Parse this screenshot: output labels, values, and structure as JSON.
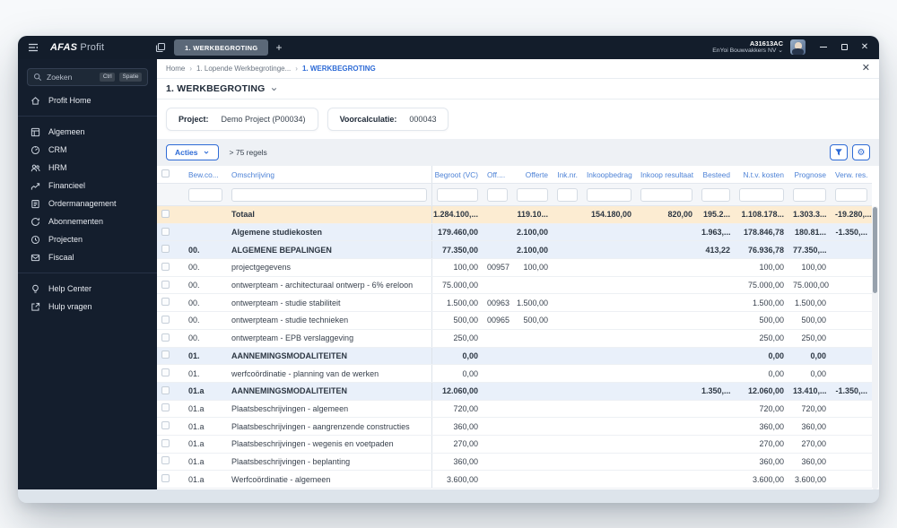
{
  "topbar": {
    "logo_primary": "AFAS",
    "logo_secondary": "Profit",
    "active_tab": "1. WERKBEGROTING",
    "user_id": "A31613AC",
    "company": "EnYoi Bouwvakkers NV"
  },
  "sidebar": {
    "search": {
      "placeholder": "Zoeken",
      "shortcut_keys": [
        "Ctrl",
        "Spatie"
      ]
    },
    "home_label": "Profit Home",
    "items": [
      {
        "icon": "grid-icon",
        "label": "Algemeen"
      },
      {
        "icon": "gauge-icon",
        "label": "CRM"
      },
      {
        "icon": "users-icon",
        "label": "HRM"
      },
      {
        "icon": "chart-icon",
        "label": "Financieel"
      },
      {
        "icon": "clipboard-icon",
        "label": "Ordermanagement"
      },
      {
        "icon": "refresh-icon",
        "label": "Abonnementen"
      },
      {
        "icon": "clock-icon",
        "label": "Projecten"
      },
      {
        "icon": "mail-icon",
        "label": "Fiscaal"
      }
    ],
    "footer_items": [
      {
        "icon": "bulb-icon",
        "label": "Help Center"
      },
      {
        "icon": "external-link-icon",
        "label": "Hulp vragen"
      }
    ]
  },
  "breadcrumb": [
    "Home",
    "1. Lopende Werkbegrotinge...",
    "1. WERKBEGROTING"
  ],
  "page": {
    "title": "1. WERKBEGROTING"
  },
  "info_cards": [
    {
      "label": "Project:",
      "value": "Demo Project (P00034)"
    },
    {
      "label": "Voorcalculatie:",
      "value": "000043"
    }
  ],
  "toolbar": {
    "actions_label": "Acties",
    "count_label": "> 75 regels"
  },
  "table": {
    "columns": [
      "",
      "Bew.co...",
      "Omschrijving",
      "Begroot (VC)",
      "Off....",
      "Offerte",
      "Ink.nr.",
      "Inkoopbedrag",
      "Inkoop resultaat",
      "Besteed",
      "N.t.v. kosten",
      "Prognose",
      "Verw. res."
    ],
    "rows": [
      {
        "variant": "total",
        "code": "",
        "descr": "Totaal",
        "begroot": "1.284.100,...",
        "offnr": "",
        "offerte": "119.10...",
        "inknr": "",
        "inkoop": "154.180,00",
        "inkres": "820,00",
        "besteed": "195.2...",
        "ntv": "1.108.178...",
        "prognose": "1.303.3...",
        "verw": "-19.280,..."
      },
      {
        "variant": "group",
        "code": "",
        "descr": "Algemene studiekosten",
        "begroot": "179.460,00",
        "offnr": "",
        "offerte": "2.100,00",
        "inknr": "",
        "inkoop": "",
        "inkres": "",
        "besteed": "1.963,...",
        "ntv": "178.846,78",
        "prognose": "180.81...",
        "verw": "-1.350,..."
      },
      {
        "variant": "group",
        "code": "00.",
        "descr": "ALGEMENE BEPALINGEN",
        "begroot": "77.350,00",
        "offnr": "",
        "offerte": "2.100,00",
        "inknr": "",
        "inkoop": "",
        "inkres": "",
        "besteed": "413,22",
        "ntv": "76.936,78",
        "prognose": "77.350,...",
        "verw": ""
      },
      {
        "variant": "normal",
        "code": "00.",
        "descr": "projectgegevens",
        "begroot": "100,00",
        "offnr": "00957",
        "offerte": "100,00",
        "inknr": "",
        "inkoop": "",
        "inkres": "",
        "besteed": "",
        "ntv": "100,00",
        "prognose": "100,00",
        "verw": ""
      },
      {
        "variant": "normal",
        "code": "00.",
        "descr": "ontwerpteam - architecturaal ontwerp - 6% ereloon",
        "begroot": "75.000,00",
        "offnr": "",
        "offerte": "",
        "inknr": "",
        "inkoop": "",
        "inkres": "",
        "besteed": "",
        "ntv": "75.000,00",
        "prognose": "75.000,00",
        "verw": ""
      },
      {
        "variant": "normal",
        "code": "00.",
        "descr": "ontwerpteam - studie stabiliteit",
        "begroot": "1.500,00",
        "offnr": "00963",
        "offerte": "1.500,00",
        "inknr": "",
        "inkoop": "",
        "inkres": "",
        "besteed": "",
        "ntv": "1.500,00",
        "prognose": "1.500,00",
        "verw": ""
      },
      {
        "variant": "normal",
        "code": "00.",
        "descr": "ontwerpteam - studie technieken",
        "begroot": "500,00",
        "offnr": "00965",
        "offerte": "500,00",
        "inknr": "",
        "inkoop": "",
        "inkres": "",
        "besteed": "",
        "ntv": "500,00",
        "prognose": "500,00",
        "verw": ""
      },
      {
        "variant": "normal",
        "code": "00.",
        "descr": "ontwerpteam - EPB verslaggeving",
        "begroot": "250,00",
        "offnr": "",
        "offerte": "",
        "inknr": "",
        "inkoop": "",
        "inkres": "",
        "besteed": "",
        "ntv": "250,00",
        "prognose": "250,00",
        "verw": ""
      },
      {
        "variant": "group",
        "code": "01.",
        "descr": "AANNEMINGSMODALITEITEN",
        "begroot": "0,00",
        "offnr": "",
        "offerte": "",
        "inknr": "",
        "inkoop": "",
        "inkres": "",
        "besteed": "",
        "ntv": "0,00",
        "prognose": "0,00",
        "verw": ""
      },
      {
        "variant": "normal",
        "code": "01.",
        "descr": "werfcoördinatie - planning van de werken",
        "begroot": "0,00",
        "offnr": "",
        "offerte": "",
        "inknr": "",
        "inkoop": "",
        "inkres": "",
        "besteed": "",
        "ntv": "0,00",
        "prognose": "0,00",
        "verw": ""
      },
      {
        "variant": "group",
        "code": "01.a",
        "descr": "AANNEMINGSMODALITEITEN",
        "begroot": "12.060,00",
        "offnr": "",
        "offerte": "",
        "inknr": "",
        "inkoop": "",
        "inkres": "",
        "besteed": "1.350,...",
        "ntv": "12.060,00",
        "prognose": "13.410,...",
        "verw": "-1.350,..."
      },
      {
        "variant": "normal",
        "code": "01.a",
        "descr": "Plaatsbeschrijvingen - algemeen",
        "begroot": "720,00",
        "offnr": "",
        "offerte": "",
        "inknr": "",
        "inkoop": "",
        "inkres": "",
        "besteed": "",
        "ntv": "720,00",
        "prognose": "720,00",
        "verw": ""
      },
      {
        "variant": "normal",
        "code": "01.a",
        "descr": "Plaatsbeschrijvingen - aangrenzende constructies",
        "begroot": "360,00",
        "offnr": "",
        "offerte": "",
        "inknr": "",
        "inkoop": "",
        "inkres": "",
        "besteed": "",
        "ntv": "360,00",
        "prognose": "360,00",
        "verw": ""
      },
      {
        "variant": "normal",
        "code": "01.a",
        "descr": "Plaatsbeschrijvingen - wegenis en voetpaden",
        "begroot": "270,00",
        "offnr": "",
        "offerte": "",
        "inknr": "",
        "inkoop": "",
        "inkres": "",
        "besteed": "",
        "ntv": "270,00",
        "prognose": "270,00",
        "verw": ""
      },
      {
        "variant": "normal",
        "code": "01.a",
        "descr": "Plaatsbeschrijvingen - beplanting",
        "begroot": "360,00",
        "offnr": "",
        "offerte": "",
        "inknr": "",
        "inkoop": "",
        "inkres": "",
        "besteed": "",
        "ntv": "360,00",
        "prognose": "360,00",
        "verw": ""
      },
      {
        "variant": "normal",
        "code": "01.a",
        "descr": "Werfcoördinatie - algemeen",
        "begroot": "3.600,00",
        "offnr": "",
        "offerte": "",
        "inknr": "",
        "inkoop": "",
        "inkres": "",
        "besteed": "",
        "ntv": "3.600,00",
        "prognose": "3.600,00",
        "verw": ""
      }
    ]
  },
  "colors": {
    "accent_blue": "#2e6bd6",
    "header_text_blue": "#4d82d6",
    "topbar_navy": "#131d2b",
    "total_row_bg": "#fcecd2",
    "group_row_bg": "#e9f0fa"
  }
}
